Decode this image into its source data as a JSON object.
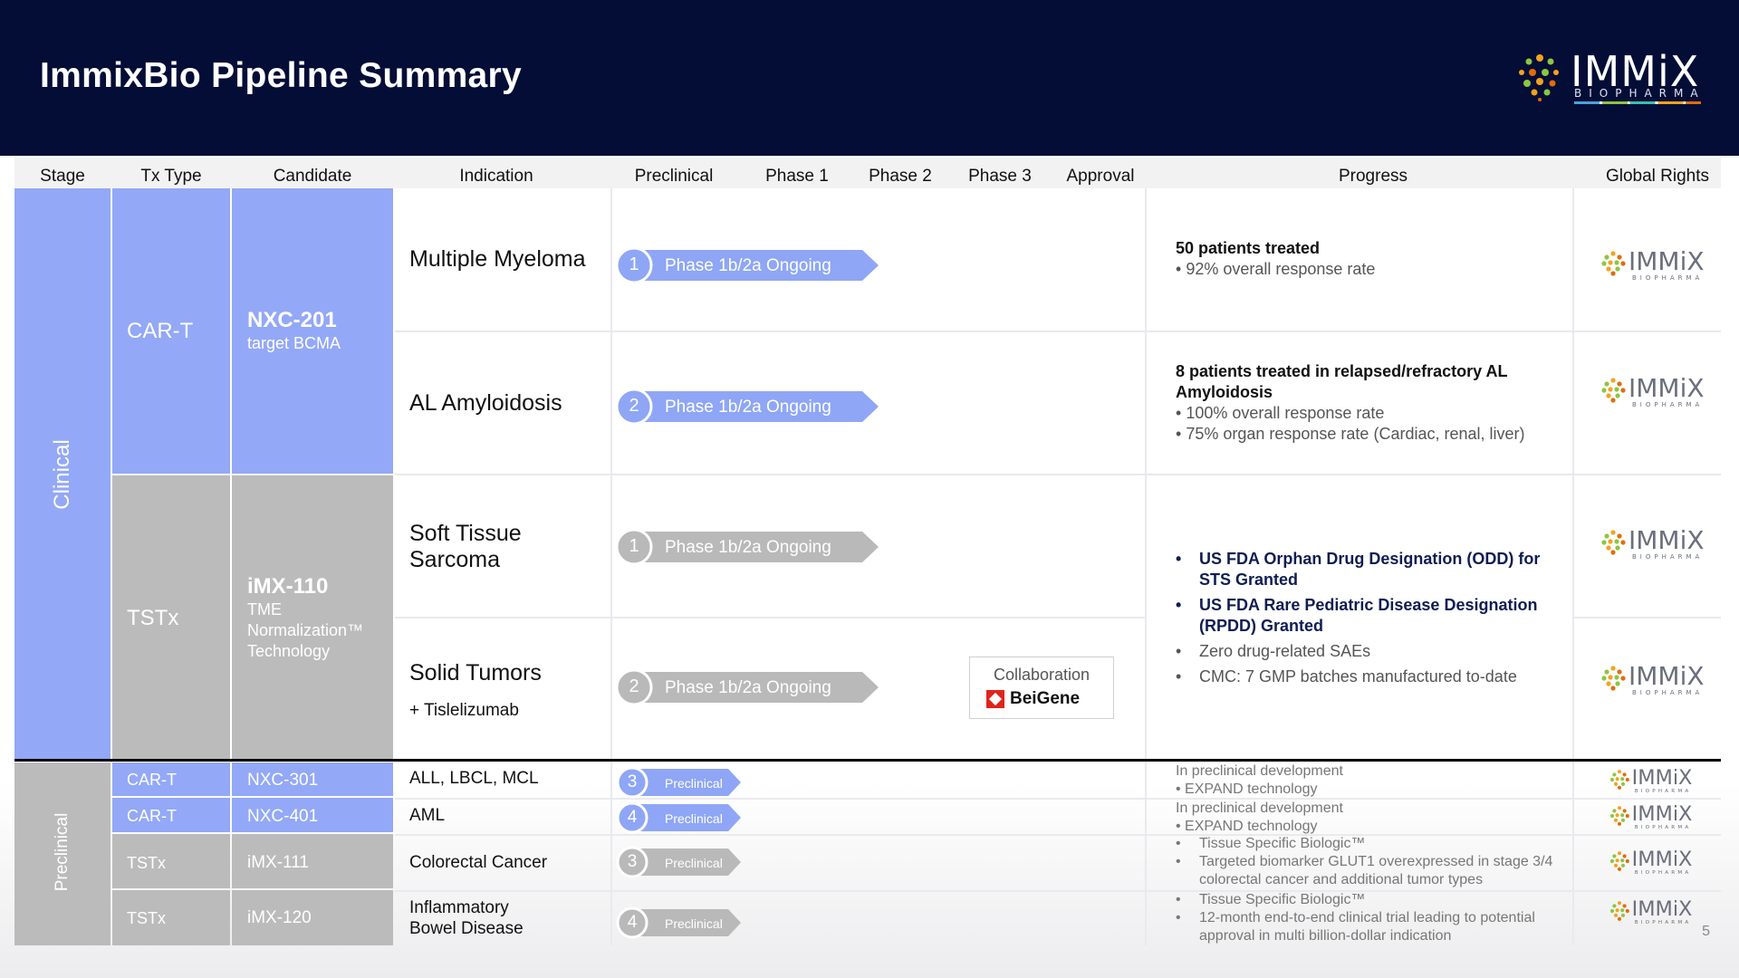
{
  "title": "ImmixBio Pipeline Summary",
  "logo": {
    "word": "IMMiX",
    "sub": "BIOPHARMA",
    "icon": "immix-dots-logo"
  },
  "columns": [
    "Stage",
    "Tx Type",
    "Candidate",
    "Indication",
    "Preclinical",
    "Phase 1",
    "Phase 2",
    "Phase 3",
    "Approval",
    "Progress",
    "Global Rights"
  ],
  "stages": {
    "clinical": "Clinical",
    "preclinical": "Preclinical"
  },
  "clinical": {
    "cart": {
      "tx": "CAR-T",
      "name": "NXC-201",
      "sub": "target BCMA"
    },
    "tstx": {
      "tx": "TSTx",
      "name": "iMX-110",
      "sub": "TME Normalization™ Technology"
    }
  },
  "rows": [
    {
      "indication": "Multiple Myeloma",
      "num": "1",
      "phase": "Phase 1b/2a Ongoing"
    },
    {
      "indication": "AL Amyloidosis",
      "num": "2",
      "phase": "Phase 1b/2a Ongoing"
    },
    {
      "indication": "Soft Tissue Sarcoma",
      "num": "1",
      "phase": "Phase 1b/2a Ongoing"
    },
    {
      "indication": "Solid Tumors",
      "indication_sub": "+ Tislelizumab",
      "num": "2",
      "phase": "Phase 1b/2a Ongoing"
    }
  ],
  "progress": {
    "mm_head": "50 patients treated",
    "mm_b1": "92% overall response rate",
    "al_head": "8 patients treated in relapsed/refractory AL Amyloidosis",
    "al_b1": "100% overall response rate",
    "al_b2": "75% organ response rate (Cardiac, renal, liver)",
    "st_b1": "US FDA Orphan Drug Designation (ODD) for STS Granted",
    "st_b2": "US FDA Rare Pediatric Disease Designation (RPDD) Granted",
    "st_b3": "Zero drug-related SAEs",
    "st_b4": "CMC: 7 GMP batches manufactured to-date"
  },
  "collab": {
    "label": "Collaboration",
    "partner": "BeiGene"
  },
  "preclinical_rows": [
    {
      "tx": "CAR-T",
      "name": "NXC-301",
      "indication": "ALL, LBCL, MCL",
      "num": "3",
      "phase": "Preclinical",
      "p1": "In preclinical development",
      "p2": "EXPAND technology"
    },
    {
      "tx": "CAR-T",
      "name": "NXC-401",
      "indication": "AML",
      "num": "4",
      "phase": "Preclinical",
      "p1": "In preclinical development",
      "p2": "EXPAND technology"
    },
    {
      "tx": "TSTx",
      "name": "iMX-111",
      "indication": "Colorectal Cancer",
      "num": "3",
      "phase": "Preclinical",
      "p1": "Tissue Specific Biologic™",
      "p2": "Targeted biomarker GLUT1 overexpressed in stage 3/4 colorectal cancer and additional tumor types"
    },
    {
      "tx": "TSTx",
      "name": "iMX-120",
      "indication": "Inflammatory Bowel Disease",
      "num": "4",
      "phase": "Preclinical",
      "p1": "Tissue Specific Biologic™",
      "p2": "12-month end-to-end clinical trial leading to potential approval in multi billion-dollar indication"
    }
  ],
  "page_number": "5",
  "colors": {
    "navy": "#030d36",
    "blue": "#93a8f7",
    "gray": "#bbbbbb",
    "pill_blue": "#8ea6f5",
    "pill_gray": "#b9b9b9",
    "beigene_red": "#e2231a"
  }
}
